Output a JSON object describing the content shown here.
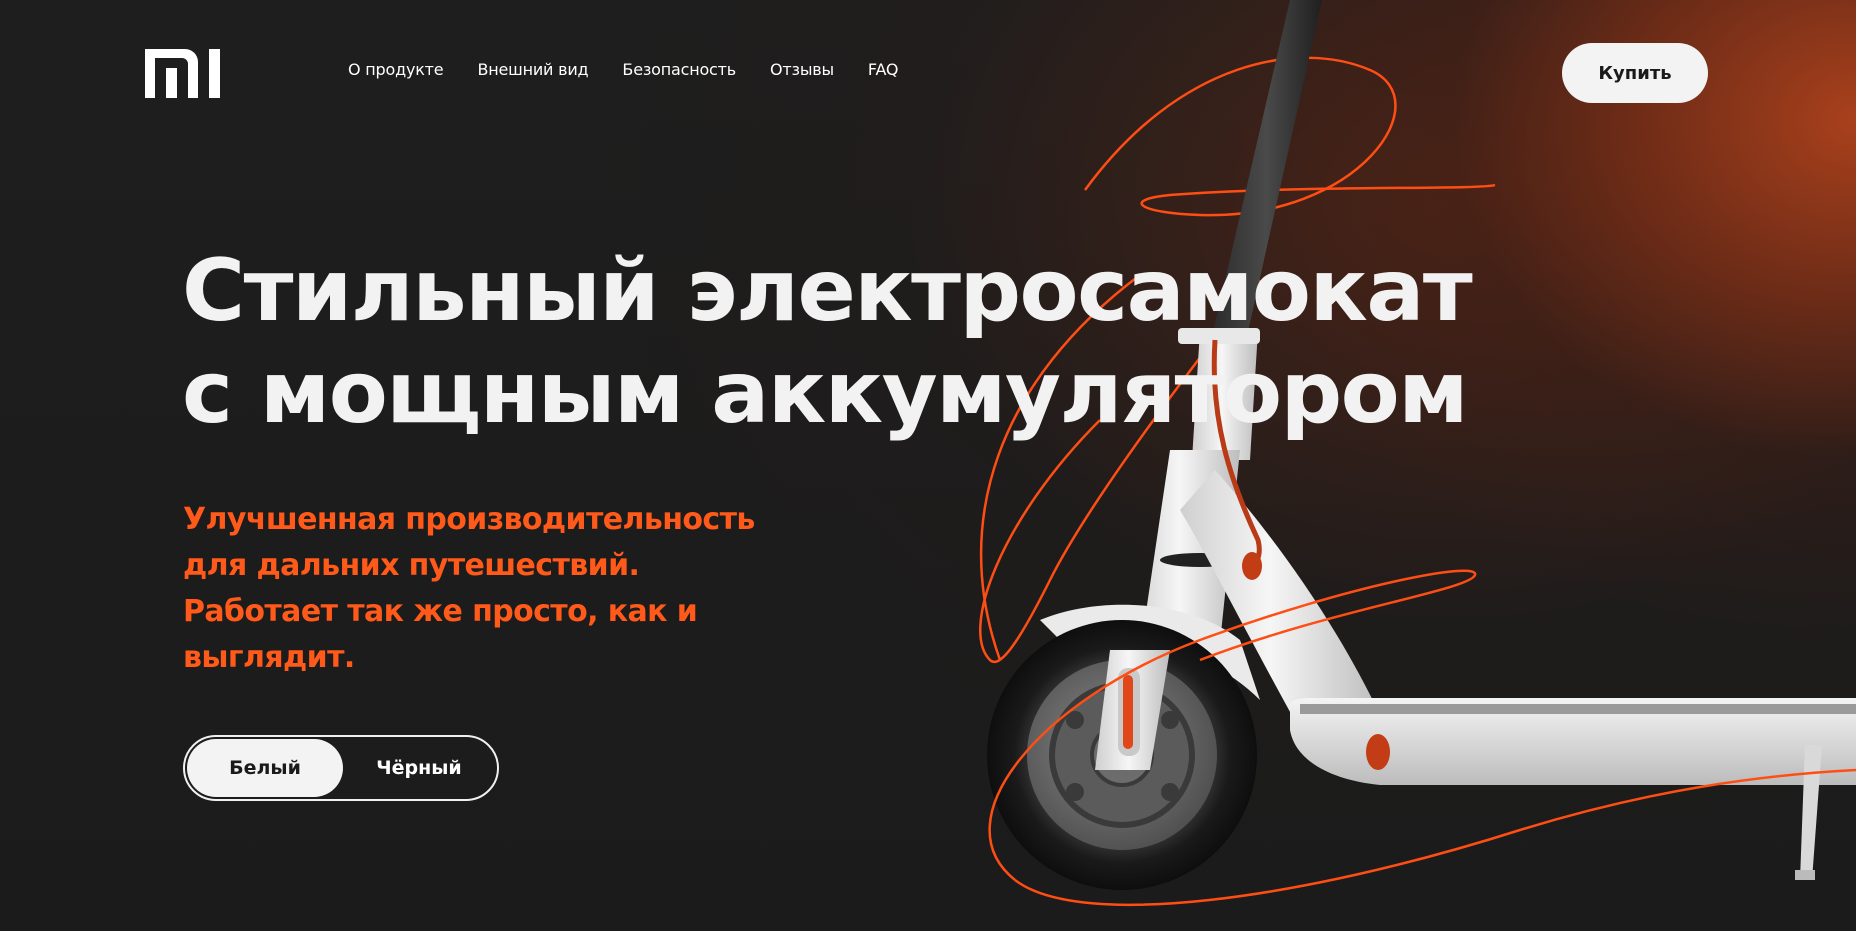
{
  "brand": {
    "logo_icon": "mi-logo-icon"
  },
  "nav": {
    "items": [
      {
        "label": "О продукте"
      },
      {
        "label": "Внешний вид"
      },
      {
        "label": "Безопасность"
      },
      {
        "label": "Отзывы"
      },
      {
        "label": "FAQ"
      }
    ]
  },
  "header": {
    "buy_label": "Купить"
  },
  "hero": {
    "headline_line1": "Стильный электросамокат",
    "headline_line2": "с мощным аккумулятором",
    "subtitle_line1": "Улучшенная производительность",
    "subtitle_line2": "для дальних путешествий.",
    "subtitle_line3": "Работает так же просто, как и",
    "subtitle_line4": "выглядит.",
    "color_options": [
      {
        "label": "Белый",
        "selected": true
      },
      {
        "label": "Чёрный",
        "selected": false
      }
    ],
    "product_image": "electric-scooter-image"
  },
  "colors": {
    "accent": "#ff5a1a",
    "background": "#1c1c1c",
    "text": "#f2f2f2",
    "button_bg": "#f3f3f3"
  }
}
